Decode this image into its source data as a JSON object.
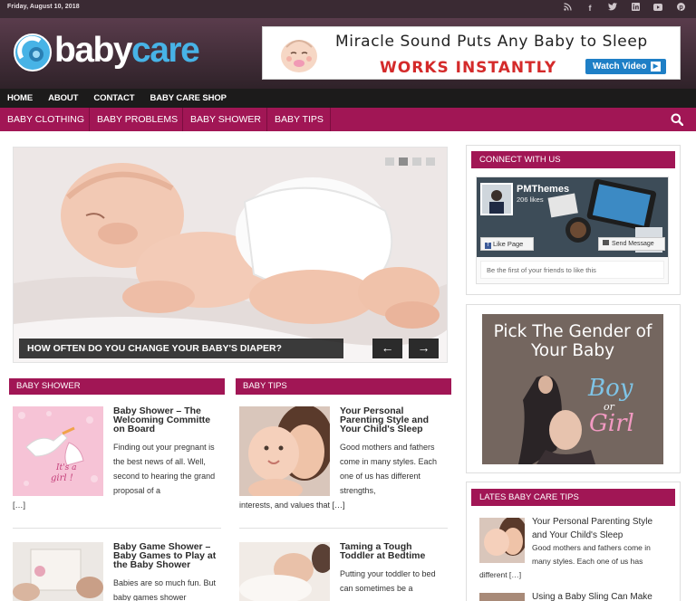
{
  "topbar": {
    "date": "Friday, August 10, 2018",
    "social_icons": [
      "rss-icon",
      "facebook-icon",
      "twitter-icon",
      "linkedin-icon",
      "youtube-icon",
      "pinterest-icon"
    ]
  },
  "header": {
    "logo": {
      "part1": "baby",
      "part2": "care"
    },
    "ad": {
      "headline": "Miracle Sound Puts Any Baby to Sleep",
      "subline": "WORKS INSTANTLY",
      "button": "Watch Video"
    }
  },
  "nav_primary": [
    "HOME",
    "ABOUT",
    "CONTACT",
    "BABY CARE SHOP"
  ],
  "nav_secondary": [
    "BABY CLOTHING",
    "BABY PROBLEMS",
    "BABY SHOWER",
    "BABY TIPS"
  ],
  "slider": {
    "caption": "HOW OFTEN DO YOU CHANGE YOUR BABY'S DIAPER?",
    "prev": "←",
    "next": "→",
    "slides": 4,
    "active_slide": 2
  },
  "columns": {
    "left": {
      "title": "BABY SHOWER",
      "posts": [
        {
          "title": "Baby Shower – The Welcoming Committe on Board",
          "excerpt": "Finding out your pregnant is the best news of all. Well, second to hearing the grand proposal of a",
          "more": "[…]",
          "image_text": "It's a girl !"
        },
        {
          "title": "Baby Game Shower – Baby Games to Play at the Baby Shower",
          "excerpt": "Babies are so much fun. But baby games shower"
        }
      ]
    },
    "right": {
      "title": "BABY TIPS",
      "posts": [
        {
          "title": "Your Personal Parenting Style and Your Child's Sleep",
          "excerpt": "Good mothers and fathers come in many styles. Each one of us has different strengths,",
          "excerpt_tail": "interests, and values that […]"
        },
        {
          "title": "Taming a Tough Toddler at Bedtime",
          "excerpt": "Putting your toddler to bed can sometimes be a"
        }
      ]
    }
  },
  "sidebar": {
    "connect": {
      "title": "CONNECT WITH US",
      "page_name": "PMThemes",
      "likes": "206 likes",
      "like_button": "Like Page",
      "send_button": "Send Message",
      "friends_text": "Be the first of your friends to like this"
    },
    "banner": {
      "title": "Pick The Gender of Your Baby",
      "boy": "Boy",
      "or": "or",
      "girl": "Girl"
    },
    "latest": {
      "title": "LATES BABY CARE TIPS",
      "posts": [
        {
          "title": "Your Personal Parenting Style and Your Child's Sleep",
          "excerpt": "Good mothers and fathers come in many styles. Each one of us has",
          "excerpt_tail": "different […]"
        },
        {
          "title": "Using a Baby Sling Can Make"
        }
      ]
    }
  },
  "colors": {
    "brand": "#a11655",
    "topbar": "#3a2a33",
    "nav_dark": "#1c1b1b",
    "logo_blue": "#47b3e6"
  }
}
